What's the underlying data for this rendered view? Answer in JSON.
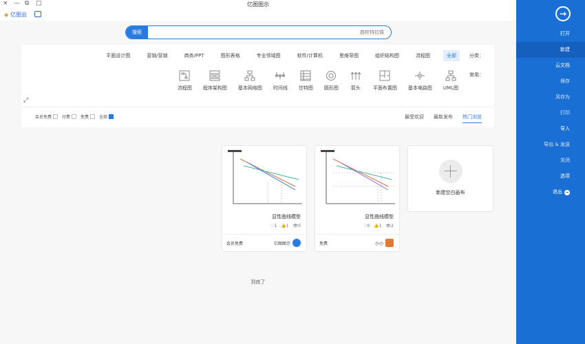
{
  "window": {
    "title": "亿图图示",
    "close": "×",
    "min": "—",
    "restore": "□",
    "dup": "⧉"
  },
  "brand": {
    "label": "亿图云"
  },
  "search": {
    "button": "搜索",
    "placeholder": "曲柱特拉佩"
  },
  "categories": {
    "label": "分类：",
    "items": [
      "全部",
      "流程图",
      "组织结构图",
      "思维导图",
      "软件/计算机",
      "专业领域图",
      "图形表格",
      "商务/PPT",
      "营销/营销",
      "平面设计图"
    ]
  },
  "common": {
    "label": "常用：",
    "items": [
      {
        "name": "UML图",
        "icon": "uml-icon"
      },
      {
        "name": "基本电路图",
        "icon": "circuit-icon"
      },
      {
        "name": "平面布置图",
        "icon": "floorplan-icon"
      },
      {
        "name": "箭头",
        "icon": "arrow-icon"
      },
      {
        "name": "圆形图",
        "icon": "circle-chart-icon"
      },
      {
        "name": "甘特图",
        "icon": "gantt-icon"
      },
      {
        "name": "时间线",
        "icon": "timeline-icon"
      },
      {
        "name": "基本网络图",
        "icon": "network-icon"
      },
      {
        "name": "程序架构图",
        "icon": "architecture-icon"
      },
      {
        "name": "流程图",
        "icon": "flowchart-icon"
      }
    ]
  },
  "sort": {
    "tabs": [
      "热门浏览",
      "最新发布",
      "最受欢迎"
    ]
  },
  "price_filters": [
    {
      "label": "全部",
      "checked": true
    },
    {
      "label": "免费",
      "checked": false
    },
    {
      "label": "付费",
      "checked": false
    },
    {
      "label": "会员免费",
      "checked": false
    }
  ],
  "new_blank": {
    "label": "新建空白画布"
  },
  "cards": [
    {
      "title": "显性曲线模型",
      "views": "2",
      "likes": "1",
      "favs": "0",
      "author": "小小",
      "price": "免费"
    },
    {
      "title": "显性曲线模型",
      "views": "0",
      "likes": "1",
      "favs": "1",
      "author": "亿图图示",
      "price": "会员免费"
    }
  ],
  "end_text": "到底了",
  "sidebar": {
    "items": [
      "打开",
      "新建",
      "云文档",
      "保存",
      "另存为",
      "打印",
      "导入",
      "导出 & 发送",
      "关闭",
      "选项",
      "退出"
    ]
  },
  "colors": {
    "accent": "#2a7ae2",
    "sidebar": "#1a6fd5"
  }
}
